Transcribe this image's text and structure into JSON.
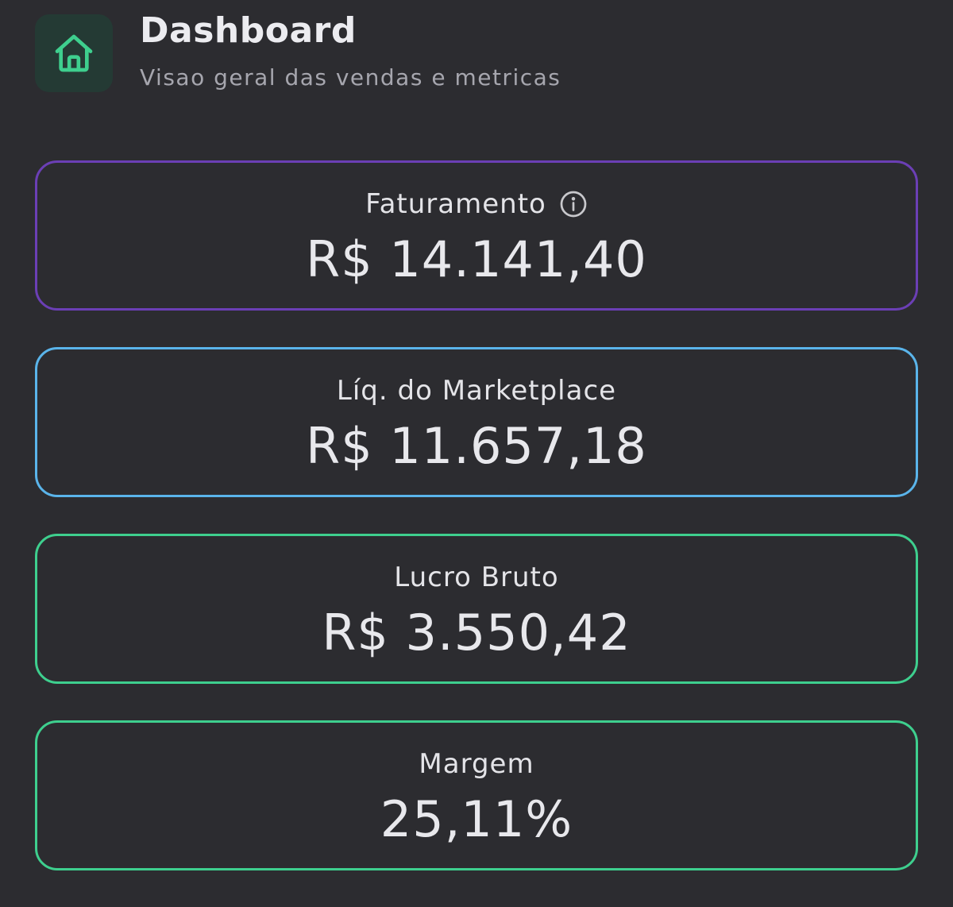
{
  "header": {
    "icon": "home-icon",
    "title": "Dashboard",
    "subtitle": "Visao geral das vendas e metricas"
  },
  "colors": {
    "background": "#2c2c30",
    "accent_green": "#3ecf8e",
    "faturamento_border": "#6b3fb5",
    "liquido_border": "#5ab4ea",
    "lucro_border": "#3ecf8e",
    "margem_border": "#3ecf8e"
  },
  "cards": [
    {
      "label": "Faturamento",
      "value": "R$ 14.141,40",
      "icon": "info-icon"
    },
    {
      "label": "Líq. do Marketplace",
      "value": "R$ 11.657,18"
    },
    {
      "label": "Lucro Bruto",
      "value": "R$ 3.550,42"
    },
    {
      "label": "Margem",
      "value": "25,11%"
    }
  ]
}
